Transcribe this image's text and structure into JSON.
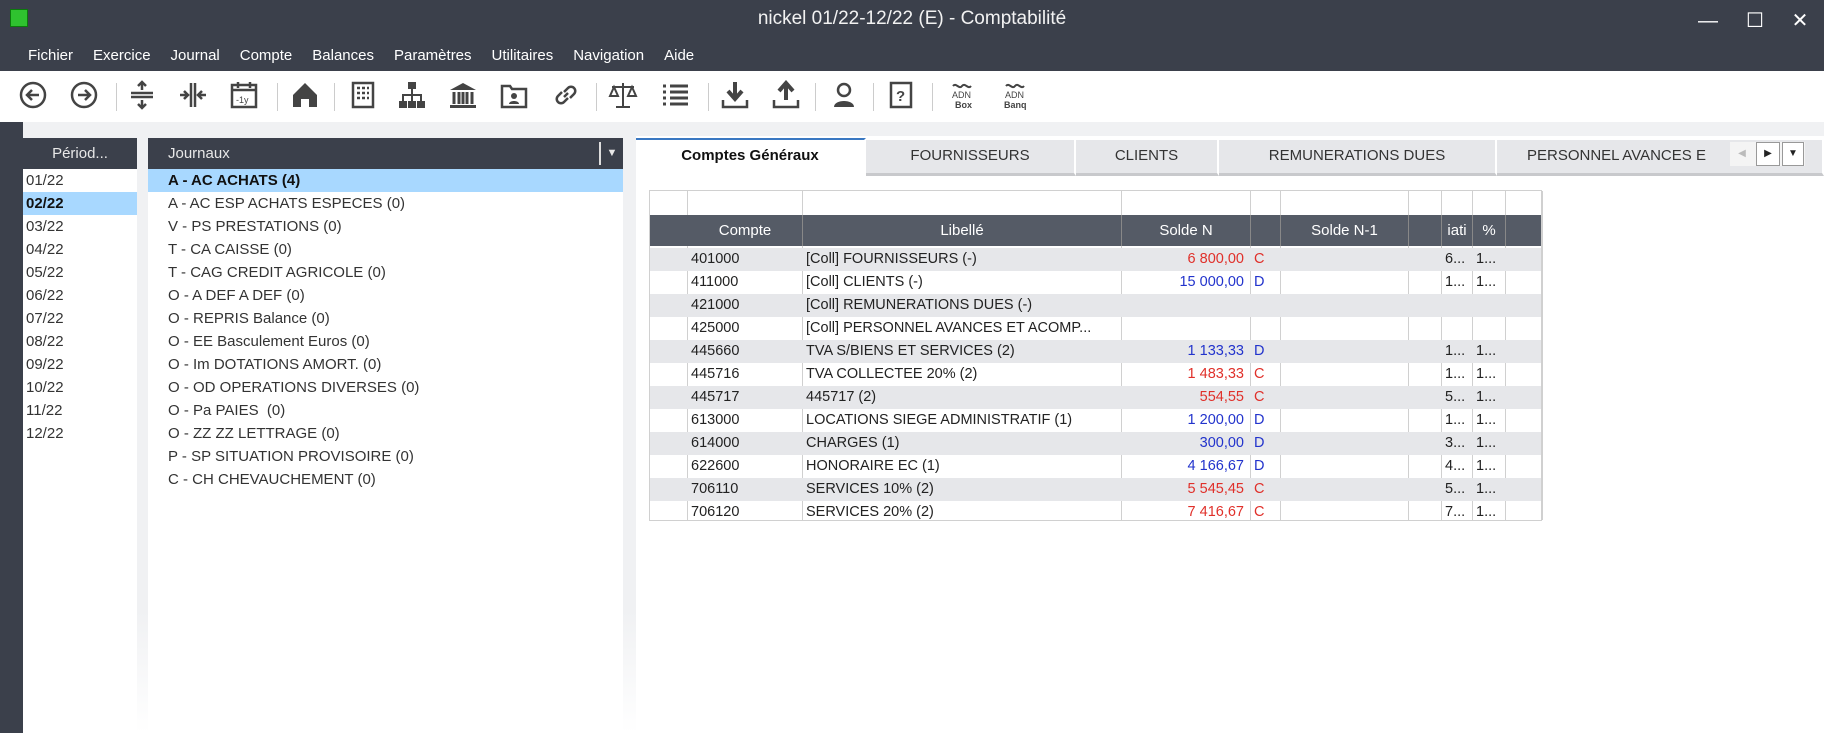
{
  "window": {
    "title": "nickel  01/22-12/22 (E) - Comptabilité",
    "minimize": "—",
    "maximize": "☐",
    "close": "✕"
  },
  "menu": [
    "Fichier",
    "Exercice",
    "Journal",
    "Compte",
    "Balances",
    "Paramètres",
    "Utilitaires",
    "Navigation",
    "Aide"
  ],
  "toolbar": [
    {
      "icon": "back-icon"
    },
    {
      "icon": "forward-icon"
    },
    {
      "icon": "expand-vertical-icon"
    },
    {
      "icon": "collapse-horizontal-icon"
    },
    {
      "icon": "calendar-minus-1y-icon",
      "label": "-1y"
    },
    {
      "icon": "home-icon"
    },
    {
      "icon": "building-icon"
    },
    {
      "icon": "org-chart-icon"
    },
    {
      "icon": "bank-icon"
    },
    {
      "icon": "contact-folder-icon"
    },
    {
      "icon": "link-icon"
    },
    {
      "icon": "balance-scale-icon"
    },
    {
      "icon": "list-icon"
    },
    {
      "icon": "download-icon"
    },
    {
      "icon": "upload-icon"
    },
    {
      "icon": "user-icon"
    },
    {
      "icon": "help-book-icon"
    },
    {
      "icon": "adn-box-icon",
      "label": "Box"
    },
    {
      "icon": "adn-banq-icon",
      "label": "Banq"
    }
  ],
  "periods": {
    "header": "Périod...",
    "items": [
      "01/22",
      "02/22",
      "03/22",
      "04/22",
      "05/22",
      "06/22",
      "07/22",
      "08/22",
      "09/22",
      "10/22",
      "11/22",
      "12/22"
    ],
    "selected": "02/22"
  },
  "journals": {
    "header": "Journaux",
    "items": [
      "A - AC ACHATS (4)",
      "A - AC ESP ACHATS ESPECES (0)",
      "V - PS PRESTATIONS (0)",
      "T - CA CAISSE (0)",
      "T - CAG CREDIT AGRICOLE (0)",
      "O - A DEF A DEF (0)",
      "O - REPRIS Balance (0)",
      "O - EE Basculement Euros (0)",
      "O - Im DOTATIONS AMORT. (0)",
      "O - OD OPERATIONS DIVERSES (0)",
      "O - Pa PAIES  (0)",
      "O - ZZ ZZ LETTRAGE (0)",
      "P - SP SITUATION PROVISOIRE (0)",
      "C - CH CHEVAUCHEMENT (0)"
    ],
    "selected": "A - AC ACHATS (4)"
  },
  "tabs": [
    "Comptes Généraux",
    "FOURNISSEURS",
    "CLIENTS",
    "REMUNERATIONS DUES",
    "PERSONNEL AVANCES E"
  ],
  "active_tab": "Comptes Généraux",
  "colors": {
    "credit": "#e0302a",
    "debit": "#2233cc",
    "selection": "#a8d8ff",
    "header": "#555b66"
  },
  "grid": {
    "columns": [
      "Compte",
      "Libellé",
      "Solde N",
      "",
      "Solde N-1",
      "",
      "iati",
      "%"
    ],
    "rows": [
      {
        "compte": "401000",
        "libelle": "[Coll] FOURNISSEURS (-)",
        "solde": "6 800,00",
        "sens": "C",
        "var": "6...",
        "pct": "1..."
      },
      {
        "compte": "411000",
        "libelle": "[Coll] CLIENTS (-)",
        "solde": "15 000,00",
        "sens": "D",
        "var": "1...",
        "pct": "1..."
      },
      {
        "compte": "421000",
        "libelle": "[Coll] REMUNERATIONS DUES (-)",
        "solde": "",
        "sens": "",
        "var": "",
        "pct": ""
      },
      {
        "compte": "425000",
        "libelle": "[Coll] PERSONNEL AVANCES ET ACOMP...",
        "solde": "",
        "sens": "",
        "var": "",
        "pct": ""
      },
      {
        "compte": "445660",
        "libelle": "TVA S/BIENS ET SERVICES        (2)",
        "solde": "1 133,33",
        "sens": "D",
        "var": "1...",
        "pct": "1..."
      },
      {
        "compte": "445716",
        "libelle": "TVA COLLECTEE 20% (2)",
        "solde": "1 483,33",
        "sens": "C",
        "var": "1...",
        "pct": "1..."
      },
      {
        "compte": "445717",
        "libelle": "445717 (2)",
        "solde": "554,55",
        "sens": "C",
        "var": "5...",
        "pct": "1..."
      },
      {
        "compte": "613000",
        "libelle": "LOCATIONS SIEGE ADMINISTRATIF (1)",
        "solde": "1 200,00",
        "sens": "D",
        "var": "1...",
        "pct": "1..."
      },
      {
        "compte": "614000",
        "libelle": "CHARGES (1)",
        "solde": "300,00",
        "sens": "D",
        "var": "3...",
        "pct": "1..."
      },
      {
        "compte": "622600",
        "libelle": "HONORAIRE EC (1)",
        "solde": "4 166,67",
        "sens": "D",
        "var": "4...",
        "pct": "1..."
      },
      {
        "compte": "706110",
        "libelle": "SERVICES 10% (2)",
        "solde": "5 545,45",
        "sens": "C",
        "var": "5...",
        "pct": "1..."
      },
      {
        "compte": "706120",
        "libelle": "SERVICES 20% (2)",
        "solde": "7 416,67",
        "sens": "C",
        "var": "7...",
        "pct": "1..."
      }
    ]
  }
}
